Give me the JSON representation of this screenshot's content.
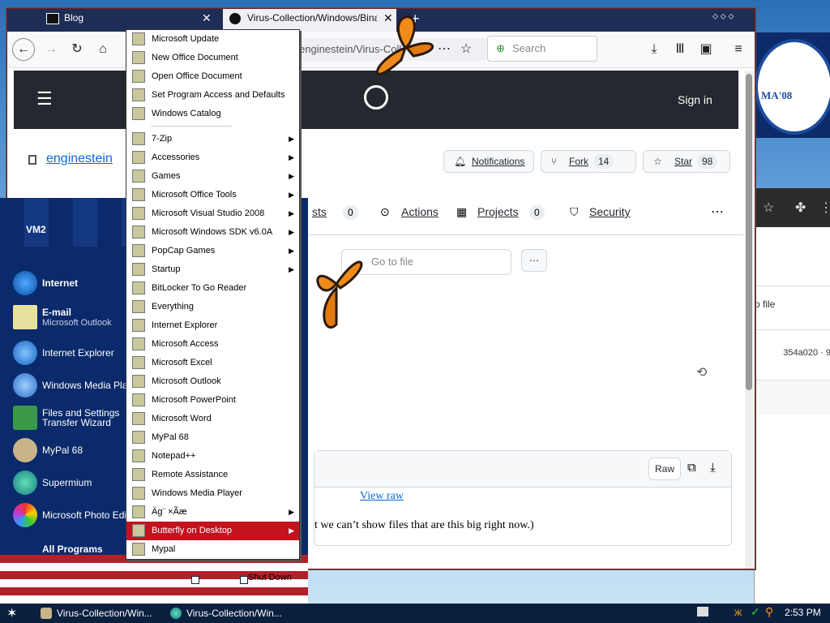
{
  "browser": {
    "tabs": [
      {
        "label": "Blog"
      },
      {
        "label": "Virus-Collection/Windows/Binaries"
      }
    ],
    "url": "enginestein/Virus-Coll",
    "search_placeholder": "Search"
  },
  "github": {
    "header": {
      "sign_in": "Sign in"
    },
    "repo_owner": "enginestein",
    "repo_sep": "/",
    "actions": {
      "notifications": "Notifications",
      "fork": "Fork",
      "fork_count": "14",
      "star": "Star",
      "star_count": "98"
    },
    "tabs": [
      {
        "label": "sts",
        "count": "0"
      },
      {
        "label": "Actions"
      },
      {
        "label": "Projects",
        "count": "0"
      },
      {
        "label": "Security"
      }
    ],
    "goto_file_placeholder": "Go to file",
    "raw_label": "Raw",
    "view_raw": "View raw",
    "too_big_msg": "t we can’t show files that are this big right now.)"
  },
  "bg_window": {
    "goto_file": "o file",
    "commit": "354a020 · 9"
  },
  "poster": {
    "text": "MA'08"
  },
  "start_menu": {
    "user": "VM2",
    "pinned": [
      {
        "title": "Internet",
        "subtitle": ""
      },
      {
        "title": "E-mail",
        "subtitle": "Microsoft Outlook"
      }
    ],
    "recent": [
      {
        "title": "Internet Explorer"
      },
      {
        "title": "Windows Media Player"
      },
      {
        "title": "Files and Settings",
        "subtitle": "Transfer Wizard"
      },
      {
        "title": "MyPal 68"
      },
      {
        "title": "Supermium"
      },
      {
        "title": "Microsoft Photo Editor"
      }
    ],
    "all_programs": "All Programs",
    "shutdown": "Shut Down"
  },
  "programs": [
    {
      "label": "Microsoft Update",
      "submenu": false
    },
    {
      "label": "New Office Document",
      "submenu": false
    },
    {
      "label": "Open Office Document",
      "submenu": false
    },
    {
      "label": "Set Program Access and Defaults",
      "submenu": false
    },
    {
      "label": "Windows Catalog",
      "submenu": false
    },
    {
      "label": "7-Zip",
      "submenu": true
    },
    {
      "label": "Accessories",
      "submenu": true
    },
    {
      "label": "Games",
      "submenu": true
    },
    {
      "label": "Microsoft Office Tools",
      "submenu": true
    },
    {
      "label": "Microsoft Visual Studio 2008",
      "submenu": true
    },
    {
      "label": "Microsoft Windows SDK v6.0A",
      "submenu": true
    },
    {
      "label": "PopCap Games",
      "submenu": true
    },
    {
      "label": "Startup",
      "submenu": true
    },
    {
      "label": "BitLocker To Go Reader",
      "submenu": false
    },
    {
      "label": "Everything",
      "submenu": false
    },
    {
      "label": "Internet Explorer",
      "submenu": false
    },
    {
      "label": "Microsoft Access",
      "submenu": false
    },
    {
      "label": "Microsoft Excel",
      "submenu": false
    },
    {
      "label": "Microsoft Outlook",
      "submenu": false
    },
    {
      "label": "Microsoft PowerPoint",
      "submenu": false
    },
    {
      "label": "Microsoft Word",
      "submenu": false
    },
    {
      "label": "MyPal 68",
      "submenu": false
    },
    {
      "label": "Notepad++",
      "submenu": false
    },
    {
      "label": "Remote Assistance",
      "submenu": false
    },
    {
      "label": "Windows Media Player",
      "submenu": false
    },
    {
      "label": "Äg¨ ×Ãæ",
      "submenu": true
    },
    {
      "label": "Butterfly on Desktop",
      "submenu": true,
      "selected": true
    },
    {
      "label": "Mypal",
      "submenu": false
    }
  ],
  "taskbar": {
    "tasks": [
      {
        "label": "Virus-Collection/Win..."
      },
      {
        "label": "Virus-Collection/Win..."
      }
    ],
    "clock": "2:53 PM"
  },
  "colors": {
    "menu_highlight": "#c5121f",
    "github_header": "#24292f",
    "taskbar": "#0b1f3f"
  }
}
